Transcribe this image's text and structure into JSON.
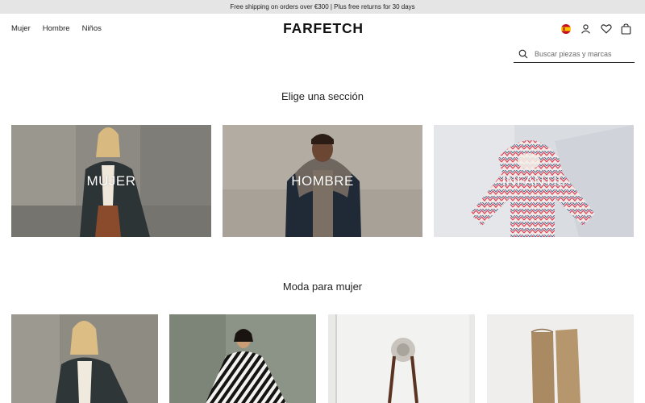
{
  "promo": {
    "text": "Free shipping on orders over €300 | Plus free returns for 30 days"
  },
  "header": {
    "nav": [
      "Mujer",
      "Hombre",
      "Niños"
    ],
    "logo": "FARFETCH",
    "icons": [
      "spain-flag-icon",
      "user-icon",
      "heart-icon",
      "bag-icon"
    ]
  },
  "search": {
    "placeholder": "Buscar piezas y marcas"
  },
  "sections": {
    "title": "Elige una sección",
    "tiles": [
      {
        "label": "MUJER"
      },
      {
        "label": "HOMBRE"
      },
      {
        "label": "INFANTIL"
      }
    ]
  },
  "women": {
    "title": "Moda para mujer"
  },
  "colors": {
    "promo_bg": "#e5e5e5",
    "text": "#222222",
    "tile_label": "#ffffff"
  }
}
